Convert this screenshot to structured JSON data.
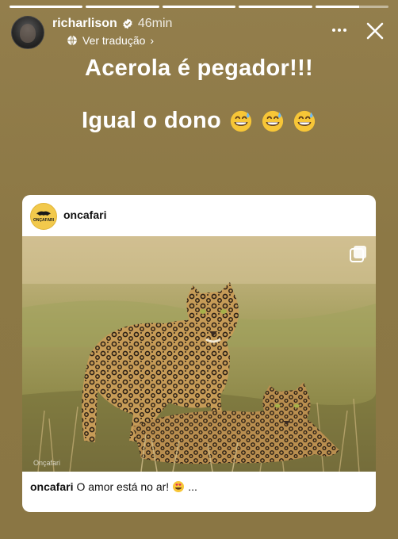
{
  "progress": [
    1,
    1,
    1,
    1,
    0.6
  ],
  "header": {
    "username": "richarlison",
    "time": "46min",
    "translate": "Ver tradução"
  },
  "caption": {
    "line1": "Acerola é pegador!!!",
    "line2": "Igual o dono"
  },
  "emoji": [
    "grinning-sweat-emoji",
    "grinning-sweat-emoji",
    "grinning-sweat-emoji"
  ],
  "post": {
    "username": "oncafari",
    "logo_text": "ONÇAFARI",
    "image_credit": "Onçafari",
    "caption_user": "oncafari",
    "caption_text": "O amor está no ar!",
    "caption_suffix": "..."
  },
  "colors": {
    "background": "#8f7b48",
    "card": "#ffffff",
    "text": "#ffffff"
  }
}
